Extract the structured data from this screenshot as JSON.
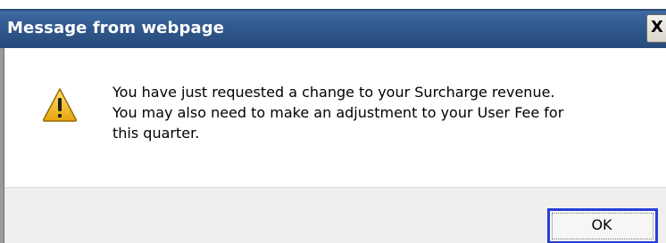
{
  "dialog": {
    "title": "Message from webpage",
    "close_label": "X",
    "message": "You have just requested a change to your Surcharge revenue.\nYou may also need to make an adjustment to your User Fee for\nthis quarter.",
    "icon": "warning-icon",
    "ok_label": "OK"
  },
  "colors": {
    "titlebar": "#30578b",
    "title_text": "#ffffff",
    "ok_focus_border": "#2a3fd6",
    "warning_fill": "#f5c31a"
  }
}
